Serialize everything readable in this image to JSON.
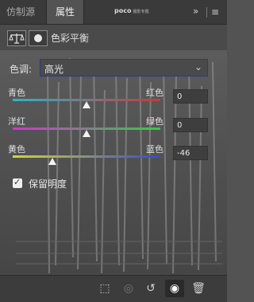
{
  "tabs": [
    {
      "label": "仿制源"
    },
    {
      "label": "属性"
    }
  ],
  "watermark": {
    "brand": "poco",
    "sub": "摄影专题"
  },
  "toolbar": {
    "collapse_icon": "double-chevron-right",
    "menu_icon": "hamburger-menu"
  },
  "header": {
    "title": "色彩平衡",
    "icon_balance": "balance-scale",
    "icon_mask": "layer-mask"
  },
  "tone": {
    "label": "色调:",
    "value": "高光"
  },
  "sliders": [
    {
      "left": "青色",
      "right": "红色",
      "value": "0",
      "position": 0.5,
      "colors": [
        "#2ab5c8",
        "#c83a3a"
      ]
    },
    {
      "left": "洋红",
      "right": "绿色",
      "value": "0",
      "position": 0.5,
      "colors": [
        "#c83ac8",
        "#3ac84a"
      ]
    },
    {
      "left": "黄色",
      "right": "蓝色",
      "value": "-46",
      "position": 0.27,
      "colors": [
        "#d4d43a",
        "#3a4ac8"
      ]
    }
  ],
  "preserve_luminosity": {
    "label": "保留明度",
    "checked": true
  },
  "footer": {
    "buttons": [
      "clip-to-layer",
      "view-previous",
      "reset",
      "visibility",
      "delete"
    ]
  }
}
